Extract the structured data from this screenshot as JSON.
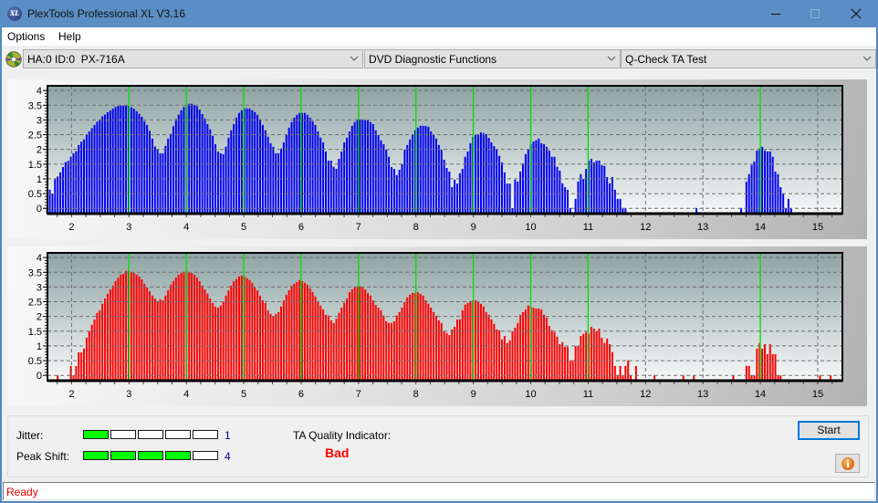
{
  "window": {
    "title": "PlexTools Professional XL V3.16",
    "logo_text": "XL"
  },
  "menu": {
    "items": [
      "Options",
      "Help"
    ]
  },
  "toolbar": {
    "drive_select": {
      "value": "HA:0 ID:0  PX-716A"
    },
    "function_select": {
      "value": "DVD Diagnostic Functions"
    },
    "test_select": {
      "value": "Q-Check TA Test"
    }
  },
  "chart_data": [
    {
      "type": "bar",
      "title": "",
      "xlabel": "",
      "ylabel": "",
      "xlim": [
        1.58,
        15.43
      ],
      "ylim": [
        -0.18,
        4.16
      ],
      "xticks": [
        2,
        3,
        4,
        5,
        6,
        7,
        8,
        9,
        10,
        11,
        12,
        13,
        14,
        15
      ],
      "yticks": [
        0,
        0.5,
        1,
        1.5,
        2,
        2.5,
        3,
        3.5,
        4
      ],
      "grid": true,
      "markers_x": [
        3,
        4,
        5,
        6,
        7,
        8,
        9,
        10,
        11,
        14
      ],
      "marker_color": "#00e000",
      "x_start": 1.575,
      "x_step": 0.0458,
      "series": [
        {
          "color": "#0000f0",
          "values": [
            0.0,
            0.63,
            0.5,
            1.0,
            1.08,
            1.22,
            1.4,
            1.57,
            1.61,
            1.75,
            1.87,
            1.94,
            2.15,
            2.26,
            2.34,
            2.51,
            2.61,
            2.72,
            2.83,
            2.94,
            3.02,
            3.12,
            3.18,
            3.26,
            3.32,
            3.38,
            3.44,
            3.48,
            3.49,
            3.49,
            3.51,
            3.48,
            3.43,
            3.38,
            3.3,
            3.21,
            3.11,
            2.96,
            2.83,
            2.63,
            2.37,
            2.1,
            1.99,
            1.87,
            1.87,
            2.12,
            2.37,
            2.53,
            2.79,
            3.03,
            3.18,
            3.33,
            3.44,
            3.52,
            3.55,
            3.55,
            3.51,
            3.47,
            3.35,
            3.2,
            3.05,
            2.86,
            2.68,
            2.46,
            2.18,
            1.93,
            1.87,
            1.84,
            2.09,
            2.4,
            2.65,
            2.86,
            3.08,
            3.24,
            3.33,
            3.39,
            3.39,
            3.39,
            3.33,
            3.27,
            3.17,
            3.02,
            2.83,
            2.65,
            2.43,
            2.21,
            2.09,
            1.87,
            1.87,
            2.03,
            2.24,
            2.52,
            2.74,
            2.93,
            3.08,
            3.17,
            3.24,
            3.24,
            3.24,
            3.17,
            3.08,
            2.96,
            2.83,
            2.61,
            2.4,
            2.24,
            1.93,
            1.62,
            1.62,
            1.41,
            1.34,
            1.68,
            1.93,
            2.24,
            2.4,
            2.61,
            2.8,
            2.93,
            3.02,
            3.02,
            3.02,
            3.0,
            2.99,
            2.93,
            2.86,
            2.65,
            2.49,
            2.31,
            2.18,
            1.99,
            1.75,
            1.4,
            1.34,
            1.13,
            1.31,
            1.5,
            1.99,
            2.15,
            2.34,
            2.52,
            2.65,
            2.74,
            2.8,
            2.8,
            2.8,
            2.77,
            2.61,
            2.52,
            2.37,
            2.15,
            1.99,
            1.65,
            1.37,
            1.25,
            0.72,
            0.97,
            0.84,
            1.19,
            1.34,
            1.75,
            1.93,
            2.21,
            2.43,
            2.49,
            2.52,
            2.58,
            2.55,
            2.52,
            2.39,
            2.24,
            2.11,
            1.99,
            1.78,
            1.56,
            1.22,
            0.84,
            0.84,
            0.01,
            0.97,
            0.91,
            1.25,
            1.53,
            1.84,
            1.99,
            2.18,
            2.27,
            2.31,
            2.37,
            2.21,
            2.18,
            2.09,
            1.96,
            1.75,
            1.75,
            1.41,
            1.28,
            0.85,
            0.72,
            0.63,
            0.01,
            null,
            0.32,
            0.91,
            1.16,
            1.0,
            1.34,
            1.62,
            1.68,
            1.56,
            1.62,
            1.62,
            1.47,
            1.44,
            1.06,
            0.85,
            1.06,
            0.63,
            0.32,
            0.32,
            0.01,
            0.01,
            null,
            null,
            null,
            null,
            null,
            null,
            null,
            null,
            null,
            null,
            null,
            null,
            null,
            null,
            null,
            null,
            null,
            null,
            null,
            null,
            null,
            null,
            null,
            null,
            null,
            null,
            0.01,
            null,
            null,
            null,
            null,
            null,
            null,
            null,
            null,
            null,
            null,
            null,
            null,
            null,
            null,
            null,
            null,
            0.01,
            null,
            0.91,
            1.16,
            1.47,
            1.59,
            1.96,
            2.03,
            2.09,
            1.96,
            1.93,
            1.93,
            1.75,
            1.25,
            1.16,
            0.72,
            0.51,
            0.01,
            0.32,
            0.01,
            null,
            null,
            null,
            null,
            null,
            null,
            null,
            null,
            null,
            null,
            null,
            null,
            null,
            null,
            null
          ]
        }
      ]
    },
    {
      "type": "bar",
      "title": "",
      "xlabel": "",
      "ylabel": "",
      "xlim": [
        1.58,
        15.43
      ],
      "ylim": [
        -0.18,
        4.16
      ],
      "xticks": [
        2,
        3,
        4,
        5,
        6,
        7,
        8,
        9,
        10,
        11,
        12,
        13,
        14,
        15
      ],
      "yticks": [
        0,
        0.5,
        1,
        1.5,
        2,
        2.5,
        3,
        3.5,
        4
      ],
      "grid": true,
      "markers_x": [
        3,
        4,
        5,
        6,
        7,
        8,
        9,
        10,
        11,
        14
      ],
      "marker_color": "#00e000",
      "x_start": 1.575,
      "x_step": 0.0458,
      "series": [
        {
          "color": "#ff0000",
          "values": [
            null,
            null,
            null,
            null,
            0.0,
            null,
            null,
            null,
            null,
            0.32,
            0.0,
            0.32,
            0.78,
            0.78,
            0.91,
            1.28,
            1.5,
            1.72,
            1.9,
            2.12,
            2.21,
            2.43,
            2.61,
            2.77,
            2.92,
            3.05,
            3.2,
            3.32,
            3.42,
            3.45,
            3.55,
            3.55,
            3.51,
            3.48,
            3.42,
            3.36,
            3.26,
            3.11,
            2.98,
            2.86,
            2.71,
            2.61,
            2.52,
            2.58,
            2.55,
            2.71,
            2.89,
            3.08,
            3.2,
            3.32,
            3.42,
            3.48,
            3.51,
            3.55,
            3.51,
            3.48,
            3.42,
            3.32,
            3.2,
            3.05,
            2.92,
            2.77,
            2.61,
            2.46,
            2.34,
            2.3,
            2.37,
            2.49,
            2.71,
            2.89,
            3.05,
            3.2,
            3.27,
            3.36,
            3.39,
            3.36,
            3.3,
            3.24,
            3.14,
            2.99,
            2.89,
            2.71,
            2.55,
            2.46,
            2.21,
            2.09,
            1.99,
            2.09,
            2.15,
            2.34,
            2.55,
            2.74,
            2.89,
            3.05,
            3.11,
            3.17,
            3.24,
            3.2,
            3.14,
            3.08,
            2.96,
            2.83,
            2.68,
            2.52,
            2.37,
            2.24,
            2.06,
            2.03,
            1.87,
            1.78,
            1.93,
            2.12,
            2.3,
            2.46,
            2.61,
            2.83,
            2.92,
            3.02,
            3.02,
            3.02,
            2.99,
            2.92,
            2.8,
            2.71,
            2.55,
            2.4,
            2.3,
            2.21,
            2.03,
            1.84,
            1.78,
            1.78,
            1.84,
            2.03,
            2.15,
            2.3,
            2.49,
            2.65,
            2.74,
            2.8,
            2.8,
            2.83,
            2.77,
            2.71,
            2.55,
            2.43,
            2.3,
            2.15,
            2.03,
            1.87,
            1.78,
            1.5,
            1.44,
            1.37,
            1.56,
            1.65,
            1.9,
            1.9,
            2.21,
            2.4,
            2.46,
            2.52,
            2.55,
            2.55,
            2.52,
            2.43,
            2.34,
            2.15,
            2.06,
            1.9,
            1.75,
            1.56,
            1.53,
            1.22,
            1.34,
            1.1,
            1.19,
            1.5,
            1.62,
            1.78,
            2.06,
            2.15,
            2.24,
            2.37,
            2.34,
            2.3,
            2.27,
            2.27,
            2.24,
            2.06,
            1.96,
            1.68,
            1.53,
            1.47,
            1.31,
            1.06,
            1.13,
            0.97,
            0.97,
            0.51,
            0.51,
            1.0,
            1.0,
            1.34,
            1.41,
            1.47,
            1.41,
            1.65,
            1.59,
            1.5,
            1.59,
            1.28,
            1.1,
            1.25,
            1.06,
            0.79,
            0.32,
            0.0,
            0.32,
            0.0,
            0.32,
            0.51,
            0.0,
            null,
            0.32,
            null,
            null,
            null,
            null,
            null,
            null,
            0.0,
            null,
            null,
            null,
            null,
            null,
            null,
            null,
            null,
            null,
            null,
            0.0,
            null,
            null,
            null,
            0.0,
            null,
            null,
            null,
            null,
            null,
            null,
            null,
            null,
            null,
            null,
            null,
            null,
            null,
            null,
            0.0,
            null,
            null,
            null,
            null,
            0.32,
            0.32,
            0.0,
            0.0,
            0.91,
            1.1,
            0.91,
            1.06,
            0.72,
            1.06,
            0.72,
            0.72,
            0.0,
            0.0,
            null,
            null,
            null,
            null,
            null,
            null,
            null,
            null,
            null,
            null,
            null,
            null,
            null,
            null,
            0.0,
            null,
            null,
            null,
            0.0
          ]
        }
      ]
    }
  ],
  "results": {
    "jitter": {
      "label": "Jitter:",
      "value": 1,
      "max": 5
    },
    "peak_shift": {
      "label": "Peak Shift:",
      "value": 4,
      "max": 5
    },
    "segment_fill_color": "#00ff00",
    "ta_quality": {
      "label": "TA Quality Indicator:",
      "value": "Bad",
      "color": "#ff0000"
    }
  },
  "buttons": {
    "start": "Start",
    "info_icon": "info-icon"
  },
  "status": {
    "text": "Ready",
    "color": "#e00000"
  }
}
